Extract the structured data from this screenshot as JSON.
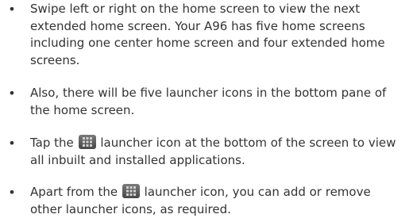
{
  "bullet_char": "•",
  "items": [
    {
      "lines": [
        "Swipe left or right on the home screen to view the next",
        "extended home screen. Your A96 has five home screens",
        "including one center home screen and four extended home",
        "screens."
      ]
    },
    {
      "lines": [
        "Also, there will be five launcher icons in the bottom pane of",
        "the home screen."
      ]
    },
    {
      "line1_before_icon": "Tap the",
      "line1_after_icon": "launcher icon at the bottom of the screen to view",
      "line2": "all inbuilt and installed applications.",
      "icon": "app-launcher-icon"
    },
    {
      "line1_before_icon": "Apart from the",
      "line1_after_icon": "launcher icon, you can add or remove",
      "line2": "other launcher icons, as required.",
      "icon": "app-launcher-icon"
    }
  ]
}
